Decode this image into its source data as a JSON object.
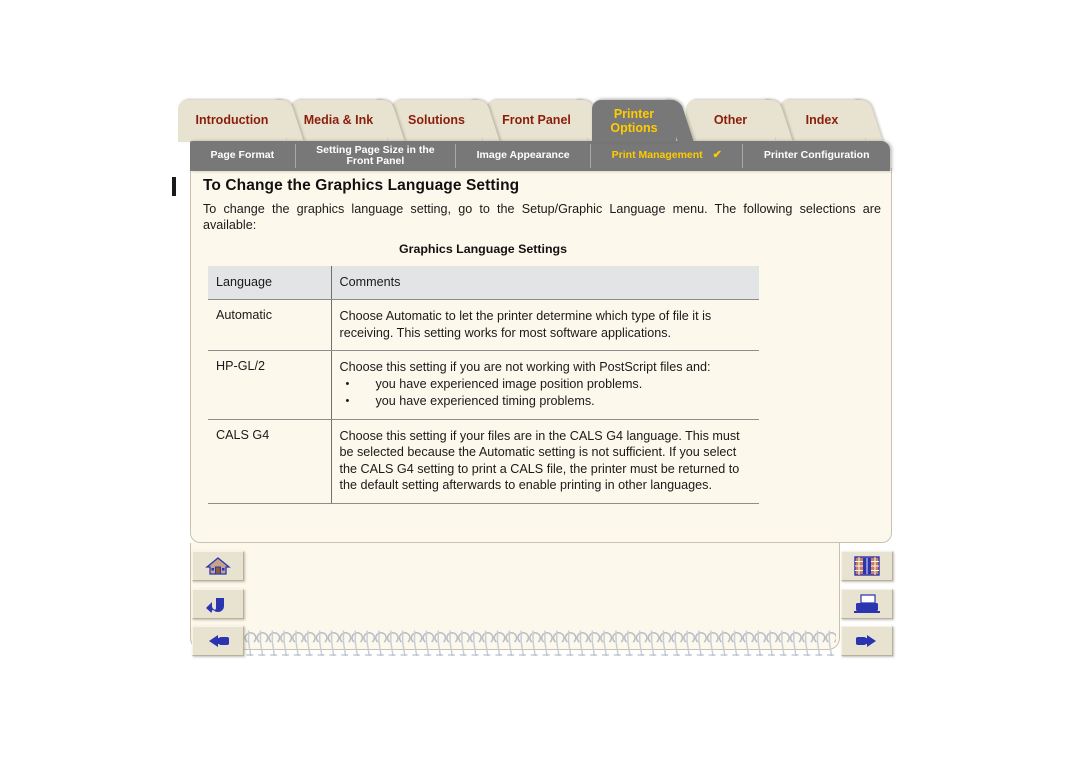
{
  "document": {
    "heading": "To Change the Graphics Language Setting",
    "intro": "To change the graphics language setting, go to the Setup/Graphic Language menu. The following selections are available:",
    "table_title": "Graphics Language Settings"
  },
  "main_tabs": [
    {
      "label": "Introduction",
      "active": false
    },
    {
      "label": "Media & Ink",
      "active": false
    },
    {
      "label": "Solutions",
      "active": false
    },
    {
      "label": "Front Panel",
      "active": false
    },
    {
      "label_line1": "Printer",
      "label_line2": "Options",
      "active": true
    },
    {
      "label": "Other",
      "active": false
    },
    {
      "label": "Index",
      "active": false
    }
  ],
  "sub_tabs": [
    {
      "label": "Page Format",
      "active": false,
      "check": ""
    },
    {
      "label_line1": "Setting Page Size in the",
      "label_line2": "Front Panel",
      "active": false,
      "check": ""
    },
    {
      "label": "Image Appearance",
      "active": false,
      "check": ""
    },
    {
      "label": "Print Management",
      "active": true,
      "check": "✔"
    },
    {
      "label": "Printer Configuration",
      "active": false,
      "check": ""
    }
  ],
  "table": {
    "headers": [
      "Language",
      "Comments"
    ],
    "rows": [
      {
        "language": "Automatic",
        "comment": "Choose Automatic to let the printer determine which type of file it is receiving. This setting works for most software applications.",
        "bullets": []
      },
      {
        "language": "HP-GL/2",
        "comment": "Choose this setting if you are not working with PostScript files and:",
        "bullets": [
          "you have experienced image position problems.",
          "you have experienced timing problems."
        ]
      },
      {
        "language": "CALS G4",
        "comment": "Choose this setting if your files are in the CALS G4 language. This must be selected because the Automatic setting is not sufficient. If you select the CALS G4 setting to print a CALS file, the printer must be returned to the default setting afterwards to enable printing in other languages.",
        "bullets": []
      }
    ]
  },
  "nav_buttons": {
    "left": [
      {
        "icon": "home-icon",
        "title": "Home"
      },
      {
        "icon": "back-arrow-icon",
        "title": "Back"
      },
      {
        "icon": "hand-pointer-left-icon",
        "title": "Previous page"
      }
    ],
    "right": [
      {
        "icon": "bookshelf-icon",
        "title": "Bookshelf"
      },
      {
        "icon": "printer-icon",
        "title": "Print"
      },
      {
        "icon": "hand-pointer-right-icon",
        "title": "Next page"
      }
    ]
  },
  "colors": {
    "tab_inactive_bg": "#e8e2d0",
    "tab_inactive_text": "#8a1e0a",
    "tab_active_bg": "#787878",
    "tab_active_text": "#ffcc00",
    "page_bg": "#fdf8ec",
    "table_header_bg": "#e2e4e6",
    "icon_blue": "#2b35b0",
    "page_white": "#ffffff"
  }
}
